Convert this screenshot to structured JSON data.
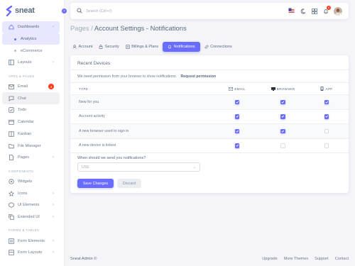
{
  "brand": {
    "name": "sneat",
    "accent": "#696cff"
  },
  "sidebar": {
    "items": [
      {
        "type": "item",
        "label": "Dashboards",
        "icon": "home-icon",
        "chevron": true,
        "state": "active"
      },
      {
        "type": "sub",
        "label": "Analytics",
        "state": "active"
      },
      {
        "type": "sub",
        "label": "eCommerce"
      },
      {
        "type": "item",
        "label": "Layouts",
        "icon": "layout-icon",
        "chevron": true
      },
      {
        "type": "section",
        "label": "APPS & PAGES"
      },
      {
        "type": "item",
        "label": "Email",
        "icon": "email-icon",
        "badge": "4"
      },
      {
        "type": "item",
        "label": "Chat",
        "icon": "chat-icon",
        "state": "soft"
      },
      {
        "type": "item",
        "label": "Todo",
        "icon": "check-icon"
      },
      {
        "type": "item",
        "label": "Calendar",
        "icon": "calendar-icon"
      },
      {
        "type": "item",
        "label": "Kanban",
        "icon": "grid-icon"
      },
      {
        "type": "item",
        "label": "File Manager",
        "icon": "folder-icon"
      },
      {
        "type": "item",
        "label": "Pages",
        "icon": "page-icon",
        "chevron": true
      },
      {
        "type": "section",
        "label": "COMPONENTS"
      },
      {
        "type": "item",
        "label": "Widgets",
        "icon": "widget-icon"
      },
      {
        "type": "item",
        "label": "Icons",
        "icon": "star-icon",
        "chevron": true
      },
      {
        "type": "item",
        "label": "UI Elements",
        "icon": "box-icon",
        "chevron": true
      },
      {
        "type": "item",
        "label": "Extended UI",
        "icon": "copy-icon",
        "chevron": true
      },
      {
        "type": "section",
        "label": "FORMS & TABLES"
      },
      {
        "type": "item",
        "label": "Form Elements",
        "icon": "form-icon",
        "chevron": true
      },
      {
        "type": "item",
        "label": "Form Layouts",
        "icon": "form-layout-icon",
        "chevron": true
      }
    ]
  },
  "navbar": {
    "search_placeholder": "Search (Ctrl+/)",
    "notification_count": "4"
  },
  "page": {
    "breadcrumb": "Pages /",
    "title": "Account Settings - Notifications"
  },
  "tabs": [
    {
      "label": "Account",
      "icon": "user-icon"
    },
    {
      "label": "Security",
      "icon": "lock-icon"
    },
    {
      "label": "Billings & Plans",
      "icon": "file-icon"
    },
    {
      "label": "Notifications",
      "icon": "bell-icon",
      "active": true
    },
    {
      "label": "Connections",
      "icon": "link-icon"
    }
  ],
  "card": {
    "title": "Recent Devices",
    "permission_text": "We need permission from your browser to show notifications.",
    "permission_link": "Request permission",
    "columns": {
      "type": "TYPE",
      "email": "EMAIL",
      "browser": "BROWSER",
      "app": "APP"
    },
    "rows": [
      {
        "type": "New for you",
        "email": true,
        "browser": true,
        "app": true
      },
      {
        "type": "Account activity",
        "email": true,
        "browser": true,
        "app": true
      },
      {
        "type": "A new browser used to sign in",
        "email": true,
        "browser": true,
        "app": false
      },
      {
        "type": "A new device is linked",
        "email": true,
        "browser": false,
        "app": false
      }
    ],
    "when_label": "When should we send you notifications?",
    "when_value": "USE",
    "save_label": "Save Changes",
    "discard_label": "Discard"
  },
  "footer": {
    "copyright": "Sneat Admin ©",
    "links": [
      "Upgrade",
      "More Themes",
      "Support",
      "Contact"
    ]
  }
}
